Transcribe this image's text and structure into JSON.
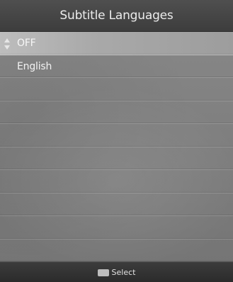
{
  "header": {
    "title": "Subtitle Languages"
  },
  "list": {
    "items": [
      {
        "label": "OFF",
        "selected": true
      },
      {
        "label": "English",
        "selected": false
      },
      {
        "label": "",
        "selected": false
      },
      {
        "label": "",
        "selected": false
      },
      {
        "label": "",
        "selected": false
      },
      {
        "label": "",
        "selected": false
      },
      {
        "label": "",
        "selected": false
      },
      {
        "label": "",
        "selected": false
      },
      {
        "label": "",
        "selected": false
      },
      {
        "label": "",
        "selected": false
      }
    ]
  },
  "footer": {
    "key_icon": "ok-key-icon",
    "action_label": "Select"
  }
}
